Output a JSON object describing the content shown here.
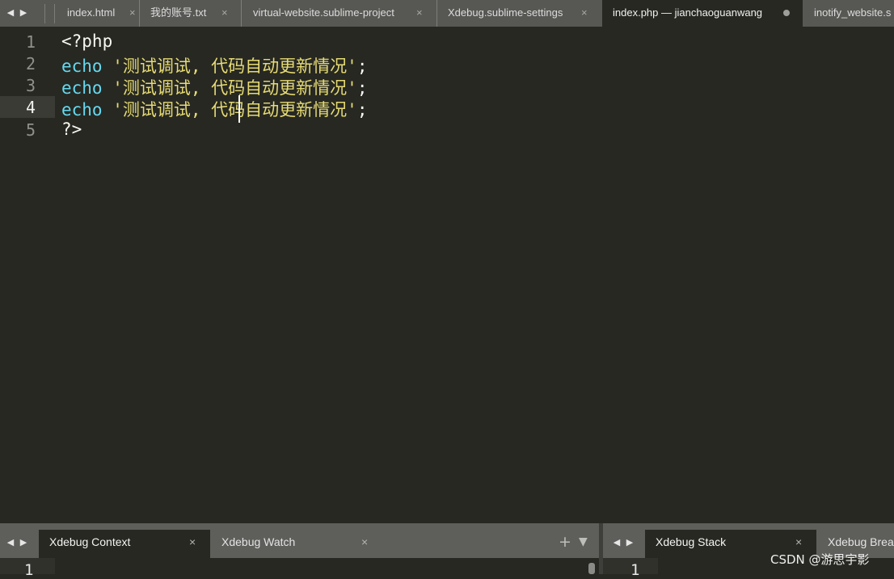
{
  "tabs": [
    {
      "label": "index.html",
      "close": "×"
    },
    {
      "label": "我的账号.txt",
      "close": "×"
    },
    {
      "label": "virtual-website.sublime-project",
      "close": "×"
    },
    {
      "label": "Xdebug.sublime-settings",
      "close": "×"
    },
    {
      "label": "index.php — jianchaoguanwang",
      "modified": true
    },
    {
      "label": "inotify_website.s"
    }
  ],
  "editor": {
    "language": "php",
    "current_line": 4,
    "lines": [
      {
        "num": "1",
        "tokens": {
          "kw": "",
          "sp": "",
          "str": "",
          "punc": "<?php"
        }
      },
      {
        "num": "2",
        "tokens": {
          "kw": "echo",
          "sp": " ",
          "str": "'测试调试, 代码自动更新情况'",
          "punc": ";"
        }
      },
      {
        "num": "3",
        "tokens": {
          "kw": "echo",
          "sp": " ",
          "str": "'测试调试, 代码自动更新情况'",
          "punc": ";"
        }
      },
      {
        "num": "4",
        "tokens": {
          "kw": "echo",
          "sp": " ",
          "str": "'测试调试, 代码自动更新情况'",
          "punc": ";"
        }
      },
      {
        "num": "5",
        "tokens": {
          "kw": "",
          "sp": "",
          "str": "",
          "punc": "?>"
        }
      }
    ]
  },
  "bottom_panels": {
    "left_tabs": [
      {
        "label": "Xdebug Context",
        "close": "×"
      },
      {
        "label": "Xdebug Watch",
        "close": "×"
      }
    ],
    "left_icons": {
      "add": "+",
      "menu": "▼"
    },
    "right_tabs": [
      {
        "label": "Xdebug Stack",
        "close": "×"
      },
      {
        "label": "Xdebug Break"
      }
    ],
    "left_line_num": "1",
    "right_line_num": "1"
  },
  "watermark": "CSDN @游思宇影",
  "colors": {
    "background": "#272822",
    "keyword": "#66d9ef",
    "string": "#e6db74",
    "text": "#f8f8f2",
    "tabbar": "#575754"
  }
}
